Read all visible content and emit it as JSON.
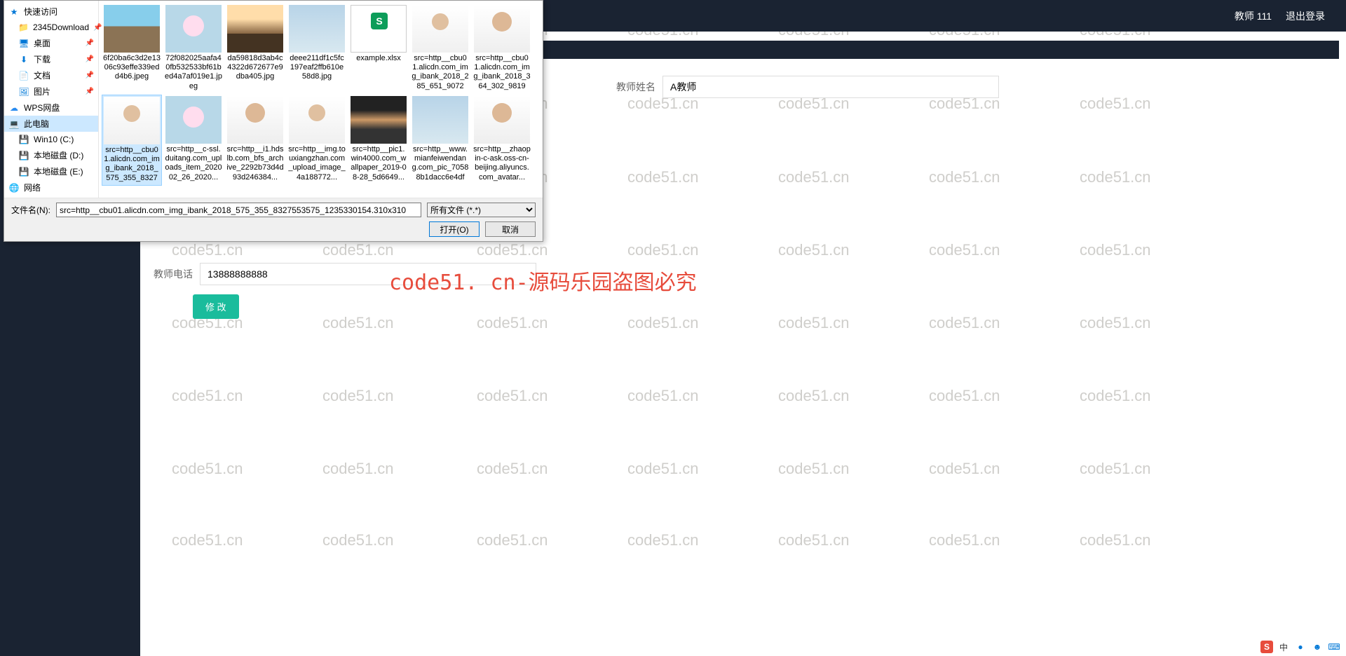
{
  "header": {
    "user": "教师 111",
    "logout": "退出登录"
  },
  "form": {
    "name_label": "教师姓名",
    "name_value": "A教师",
    "phone_label": "教师电话",
    "phone_value": "13888888888",
    "submit": "修 改"
  },
  "watermark_text": "code51.cn",
  "big_watermark": "code51. cn-源码乐园盗图必究",
  "dialog": {
    "nav": {
      "quick_access": "快速访问",
      "download_folder": "2345Download",
      "desktop": "桌面",
      "downloads": "下载",
      "documents": "文档",
      "pictures": "图片",
      "wps": "WPS网盘",
      "this_pc": "此电脑",
      "win10": "Win10 (C:)",
      "local_d": "本地磁盘 (D:)",
      "local_e": "本地磁盘 (E:)",
      "network": "网络"
    },
    "files": [
      {
        "name": "6f20ba6c3d2e1306c93effe339edd4b6.jpeg",
        "cls": "th-landscape"
      },
      {
        "name": "72f082025aafa40fb532533bf61bed4a7af019e1.jpeg",
        "cls": "th-cartoon"
      },
      {
        "name": "da59818d3ab4c4322d672677e9dba405.jpg",
        "cls": "th-city"
      },
      {
        "name": "deee211df1c5fc197eaf2ffb610e58d8.jpg",
        "cls": "th-sky"
      },
      {
        "name": "example.xlsx",
        "cls": "xlsx-icon"
      },
      {
        "name": "src=http__cbu01.alicdn.com_img_ibank_2018_285_651_90721...",
        "cls": "th-person"
      },
      {
        "name": "src=http__cbu01.alicdn.com_img_ibank_2018_364_302_98192...",
        "cls": "th-person2"
      },
      {
        "name": "src=http__cbu01.alicdn.com_img_ibank_2018_575_355_83275...",
        "cls": "th-person",
        "selected": true
      },
      {
        "name": "src=http__c-ssl.duitang.com_uploads_item_202002_26_2020...",
        "cls": "th-cartoon"
      },
      {
        "name": "src=http__i1.hdslb.com_bfs_archive_2292b73d4d93d246384...",
        "cls": "th-person2"
      },
      {
        "name": "src=http__img.touxiangzhan.com_upload_image_4a188772...",
        "cls": "th-person"
      },
      {
        "name": "src=http__pic1.win4000.com_wallpaper_2019-08-28_5d6649...",
        "cls": "th-sunset"
      },
      {
        "name": "src=http__www.mianfeiwendang.com_pic_70588b1dacc6e4df0...",
        "cls": "th-sky"
      },
      {
        "name": "src=http__zhaopin-c-ask.oss-cn-beijing.aliyuncs.com_avatar...",
        "cls": "th-person2"
      }
    ],
    "filename_label": "文件名(N):",
    "filename_value": "src=http__cbu01.alicdn.com_img_ibank_2018_575_355_8327553575_1235330154.310x310",
    "filter": "所有文件 (*.*)",
    "open_btn": "打开(O)",
    "cancel_btn": "取消"
  },
  "tray": {
    "ime": "中"
  }
}
